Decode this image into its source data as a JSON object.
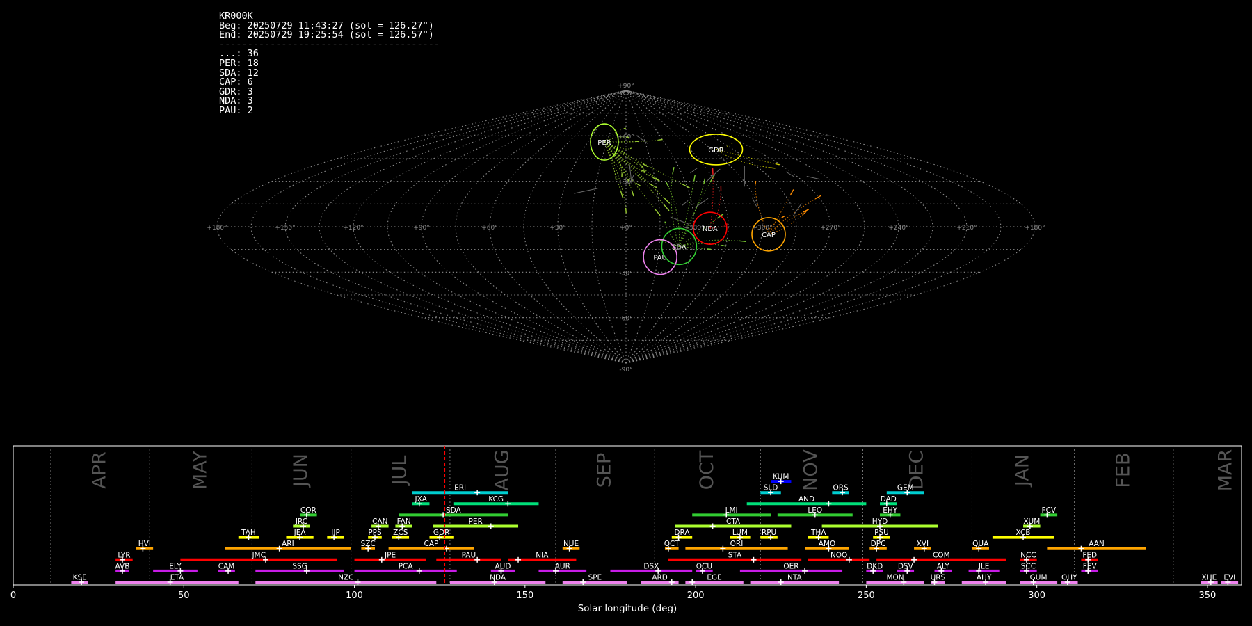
{
  "info": {
    "station": "KR000K",
    "beg": "Beg: 20250729 11:43:27 (sol = 126.27°)",
    "end": "End: 20250729 19:25:54 (sol = 126.57°)",
    "separator": "---------------------------------------",
    "counts": [
      {
        "code": "...",
        "n": 36
      },
      {
        "code": "PER",
        "n": 18
      },
      {
        "code": "SDA",
        "n": 12
      },
      {
        "code": "CAP",
        "n": 6
      },
      {
        "code": "GDR",
        "n": 3
      },
      {
        "code": "NDA",
        "n": 3
      },
      {
        "code": "PAU",
        "n": 2
      }
    ]
  },
  "chart_data": [
    {
      "type": "scatter",
      "projection": "sinusoidal",
      "lon_tick_labels": [
        "+180°",
        "+150°",
        "+120°",
        "+90°",
        "+60°",
        "+30°",
        "+0°",
        "+330°",
        "+300°",
        "+270°",
        "+240°",
        "+210°",
        "+180°"
      ],
      "lat_tick_labels": [
        "+90°",
        "+60°",
        "+30°",
        "-30°",
        "-60°",
        "-90°"
      ],
      "radiants": [
        {
          "code": "PER",
          "lon": -17,
          "lat": 56,
          "color": "#adff2f",
          "rx": 20,
          "ry": 26
        },
        {
          "code": "GDR",
          "lon": 63,
          "lat": 51,
          "color": "#ffff00",
          "rx": 38,
          "ry": 22
        },
        {
          "code": "NDA",
          "lon": 37,
          "lat": -1,
          "color": "#ff0000",
          "rx": 24,
          "ry": 23
        },
        {
          "code": "CAP",
          "lon": 63,
          "lat": -5,
          "color": "#ffa500",
          "rx": 24,
          "ry": 24
        },
        {
          "code": "SDA",
          "lon": 24,
          "lat": -13,
          "color": "#32cd32",
          "rx": 25,
          "ry": 26
        },
        {
          "code": "PAU",
          "lon": 16,
          "lat": -20,
          "color": "#ee82ee",
          "rx": 24,
          "ry": 25
        }
      ],
      "grid": true
    },
    {
      "type": "gantt",
      "xlabel": "Solar longitude (deg)",
      "xlim": [
        0,
        360
      ],
      "xticks": [
        0,
        50,
        100,
        150,
        200,
        250,
        300,
        350
      ],
      "current_sol": 126.4,
      "months": [
        {
          "name": "APR",
          "start": 11
        },
        {
          "name": "MAY",
          "start": 40
        },
        {
          "name": "JUN",
          "start": 70
        },
        {
          "name": "JUL",
          "start": 99
        },
        {
          "name": "AUG",
          "start": 128
        },
        {
          "name": "SEP",
          "start": 159
        },
        {
          "name": "OCT",
          "start": 188
        },
        {
          "name": "NOV",
          "start": 219
        },
        {
          "name": "DEC",
          "start": 249
        },
        {
          "name": "JAN",
          "start": 281
        },
        {
          "name": "FEB",
          "start": 311
        },
        {
          "name": "MAR",
          "start": 340
        }
      ],
      "showers": [
        {
          "code": "KUM",
          "s": 222,
          "e": 228,
          "p": 225,
          "row": 10,
          "color": "#0000ff"
        },
        {
          "code": "ERI",
          "s": 117,
          "e": 145,
          "p": 136,
          "row": 9,
          "color": "#00ced1"
        },
        {
          "code": "SLD",
          "s": 219,
          "e": 225,
          "p": 222,
          "row": 9,
          "color": "#00ced1"
        },
        {
          "code": "ORS",
          "s": 240,
          "e": 245,
          "p": 243,
          "row": 9,
          "color": "#00ced1"
        },
        {
          "code": "GEM",
          "s": 256,
          "e": 267,
          "p": 262,
          "row": 9,
          "color": "#00ced1"
        },
        {
          "code": "JXA",
          "s": 117,
          "e": 122,
          "p": 119,
          "row": 8,
          "color": "#00e07a"
        },
        {
          "code": "KCG",
          "s": 129,
          "e": 154,
          "p": 145,
          "row": 8,
          "color": "#00e07a"
        },
        {
          "code": "AND",
          "s": 215,
          "e": 250,
          "p": 239,
          "row": 8,
          "color": "#00e07a"
        },
        {
          "code": "DAD",
          "s": 254,
          "e": 259,
          "p": 256,
          "row": 8,
          "color": "#00e07a"
        },
        {
          "code": "COR",
          "s": 84,
          "e": 89,
          "p": 86,
          "row": 7,
          "color": "#32cd32"
        },
        {
          "code": "SDA",
          "s": 113,
          "e": 145,
          "p": 126,
          "row": 7,
          "color": "#32cd32"
        },
        {
          "code": "LMI",
          "s": 199,
          "e": 222,
          "p": 209,
          "row": 7,
          "color": "#32cd32"
        },
        {
          "code": "LEO",
          "s": 224,
          "e": 246,
          "p": 235,
          "row": 7,
          "color": "#32cd32"
        },
        {
          "code": "EHY",
          "s": 254,
          "e": 260,
          "p": 257,
          "row": 7,
          "color": "#32cd32"
        },
        {
          "code": "FCV",
          "s": 301,
          "e": 306,
          "p": 303,
          "row": 7,
          "color": "#32cd32"
        },
        {
          "code": "JRC",
          "s": 82,
          "e": 87,
          "p": 85,
          "row": 6,
          "color": "#adff2f"
        },
        {
          "code": "CAN",
          "s": 105,
          "e": 110,
          "p": 107,
          "row": 6,
          "color": "#adff2f"
        },
        {
          "code": "FAN",
          "s": 112,
          "e": 117,
          "p": 114,
          "row": 6,
          "color": "#adff2f"
        },
        {
          "code": "PER",
          "s": 123,
          "e": 148,
          "p": 140,
          "row": 6,
          "color": "#adff2f"
        },
        {
          "code": "CTA",
          "s": 194,
          "e": 228,
          "p": 205,
          "row": 6,
          "color": "#adff2f"
        },
        {
          "code": "HYD",
          "s": 237,
          "e": 271,
          "p": 254,
          "row": 6,
          "color": "#adff2f"
        },
        {
          "code": "XUM",
          "s": 296,
          "e": 301,
          "p": 298,
          "row": 6,
          "color": "#adff2f"
        },
        {
          "code": "TAH",
          "s": 66,
          "e": 72,
          "p": 69,
          "row": 5,
          "color": "#ffff00"
        },
        {
          "code": "JEA",
          "s": 80,
          "e": 88,
          "p": 84,
          "row": 5,
          "color": "#ffff00"
        },
        {
          "code": "JIP",
          "s": 92,
          "e": 97,
          "p": 94,
          "row": 5,
          "color": "#ffff00"
        },
        {
          "code": "PPS",
          "s": 104,
          "e": 108,
          "p": 106,
          "row": 5,
          "color": "#ffff00"
        },
        {
          "code": "ZCS",
          "s": 111,
          "e": 116,
          "p": 113,
          "row": 5,
          "color": "#ffff00"
        },
        {
          "code": "GDR",
          "s": 122,
          "e": 129,
          "p": 125,
          "row": 5,
          "color": "#ffff00"
        },
        {
          "code": "DRA",
          "s": 193,
          "e": 199,
          "p": 195,
          "row": 5,
          "color": "#ffff00"
        },
        {
          "code": "LUM",
          "s": 210,
          "e": 216,
          "p": 213,
          "row": 5,
          "color": "#ffff00"
        },
        {
          "code": "RPU",
          "s": 219,
          "e": 224,
          "p": 222,
          "row": 5,
          "color": "#ffff00"
        },
        {
          "code": "THA",
          "s": 233,
          "e": 239,
          "p": 236,
          "row": 5,
          "color": "#ffff00"
        },
        {
          "code": "PSU",
          "s": 252,
          "e": 257,
          "p": 254,
          "row": 5,
          "color": "#ffff00"
        },
        {
          "code": "XCB",
          "s": 287,
          "e": 305,
          "p": 296,
          "row": 5,
          "color": "#ffff00"
        },
        {
          "code": "HVI",
          "s": 36,
          "e": 41,
          "p": 38,
          "row": 4,
          "color": "#ffa500"
        },
        {
          "code": "ARI",
          "s": 62,
          "e": 99,
          "p": 78,
          "row": 4,
          "color": "#ffa500"
        },
        {
          "code": "SZC",
          "s": 102,
          "e": 106,
          "p": 104,
          "row": 4,
          "color": "#ffa500"
        },
        {
          "code": "CAP",
          "s": 110,
          "e": 135,
          "p": 127,
          "row": 4,
          "color": "#ffa500"
        },
        {
          "code": "NUE",
          "s": 161,
          "e": 166,
          "p": 163,
          "row": 4,
          "color": "#ffa500"
        },
        {
          "code": "OCT",
          "s": 191,
          "e": 195,
          "p": 192,
          "row": 4,
          "color": "#ffa500"
        },
        {
          "code": "ORI",
          "s": 197,
          "e": 227,
          "p": 208,
          "row": 4,
          "color": "#ffa500"
        },
        {
          "code": "AMO",
          "s": 232,
          "e": 245,
          "p": 239,
          "row": 4,
          "color": "#ffa500"
        },
        {
          "code": "DPC",
          "s": 251,
          "e": 256,
          "p": 253,
          "row": 4,
          "color": "#ffa500"
        },
        {
          "code": "XVI",
          "s": 264,
          "e": 269,
          "p": 267,
          "row": 4,
          "color": "#ffa500"
        },
        {
          "code": "QUA",
          "s": 281,
          "e": 286,
          "p": 283,
          "row": 4,
          "color": "#ffa500"
        },
        {
          "code": "AAN",
          "s": 303,
          "e": 332,
          "p": 313,
          "row": 4,
          "color": "#ffa500"
        },
        {
          "code": "LYR",
          "s": 30,
          "e": 35,
          "p": 32,
          "row": 3,
          "color": "#ff0000"
        },
        {
          "code": "JMC",
          "s": 49,
          "e": 95,
          "p": 74,
          "row": 3,
          "color": "#ff0000"
        },
        {
          "code": "JPE",
          "s": 100,
          "e": 121,
          "p": 108,
          "row": 3,
          "color": "#ff0000"
        },
        {
          "code": "PAU",
          "s": 124,
          "e": 143,
          "p": 136,
          "row": 3,
          "color": "#ff0000"
        },
        {
          "code": "NIA",
          "s": 145,
          "e": 165,
          "p": 148,
          "row": 3,
          "color": "#ff0000"
        },
        {
          "code": "STA",
          "s": 192,
          "e": 231,
          "p": 217,
          "row": 3,
          "color": "#ff0000"
        },
        {
          "code": "NOO",
          "s": 233,
          "e": 251,
          "p": 245,
          "row": 3,
          "color": "#ff0000"
        },
        {
          "code": "COM",
          "s": 253,
          "e": 291,
          "p": 264,
          "row": 3,
          "color": "#ff0000"
        },
        {
          "code": "NCC",
          "s": 295,
          "e": 300,
          "p": 297,
          "row": 3,
          "color": "#ff0000"
        },
        {
          "code": "FED",
          "s": 313,
          "e": 318,
          "p": 315,
          "row": 3,
          "color": "#ff0000"
        },
        {
          "code": "AVB",
          "s": 30,
          "e": 34,
          "p": 32,
          "row": 2,
          "color": "#c71ce6"
        },
        {
          "code": "ELY",
          "s": 41,
          "e": 54,
          "p": 49,
          "row": 2,
          "color": "#c71ce6"
        },
        {
          "code": "CAM",
          "s": 60,
          "e": 65,
          "p": 63,
          "row": 2,
          "color": "#c71ce6"
        },
        {
          "code": "SSG",
          "s": 71,
          "e": 97,
          "p": 86,
          "row": 2,
          "color": "#c71ce6"
        },
        {
          "code": "PCA",
          "s": 100,
          "e": 130,
          "p": 119,
          "row": 2,
          "color": "#c71ce6"
        },
        {
          "code": "AUD",
          "s": 140,
          "e": 147,
          "p": 143,
          "row": 2,
          "color": "#c71ce6"
        },
        {
          "code": "AUR",
          "s": 154,
          "e": 168,
          "p": 159,
          "row": 2,
          "color": "#c71ce6"
        },
        {
          "code": "DSX",
          "s": 175,
          "e": 199,
          "p": 189,
          "row": 2,
          "color": "#c71ce6"
        },
        {
          "code": "OCU",
          "s": 200,
          "e": 205,
          "p": 202,
          "row": 2,
          "color": "#c71ce6"
        },
        {
          "code": "OER",
          "s": 213,
          "e": 243,
          "p": 232,
          "row": 2,
          "color": "#c71ce6"
        },
        {
          "code": "DKD",
          "s": 250,
          "e": 255,
          "p": 252,
          "row": 2,
          "color": "#c71ce6"
        },
        {
          "code": "DSV",
          "s": 259,
          "e": 264,
          "p": 262,
          "row": 2,
          "color": "#c71ce6"
        },
        {
          "code": "ALY",
          "s": 270,
          "e": 275,
          "p": 272,
          "row": 2,
          "color": "#c71ce6"
        },
        {
          "code": "JLE",
          "s": 280,
          "e": 289,
          "p": 283,
          "row": 2,
          "color": "#c71ce6"
        },
        {
          "code": "SCC",
          "s": 295,
          "e": 300,
          "p": 297,
          "row": 2,
          "color": "#c71ce6"
        },
        {
          "code": "FEV",
          "s": 313,
          "e": 318,
          "p": 315,
          "row": 2,
          "color": "#c71ce6"
        },
        {
          "code": "KSE",
          "s": 17,
          "e": 22,
          "p": 20,
          "row": 1,
          "color": "#ee82ee"
        },
        {
          "code": "ETA",
          "s": 30,
          "e": 66,
          "p": 46,
          "row": 1,
          "color": "#ee82ee"
        },
        {
          "code": "NZC",
          "s": 71,
          "e": 124,
          "p": 101,
          "row": 1,
          "color": "#ee82ee"
        },
        {
          "code": "NDA",
          "s": 128,
          "e": 156,
          "p": 141,
          "row": 1,
          "color": "#ee82ee"
        },
        {
          "code": "SPE",
          "s": 161,
          "e": 180,
          "p": 167,
          "row": 1,
          "color": "#ee82ee"
        },
        {
          "code": "ARD",
          "s": 184,
          "e": 195,
          "p": 193,
          "row": 1,
          "color": "#ee82ee"
        },
        {
          "code": "EGE",
          "s": 197,
          "e": 214,
          "p": 199,
          "row": 1,
          "color": "#ee82ee"
        },
        {
          "code": "NTA",
          "s": 216,
          "e": 242,
          "p": 225,
          "row": 1,
          "color": "#ee82ee"
        },
        {
          "code": "MON",
          "s": 250,
          "e": 267,
          "p": 261,
          "row": 1,
          "color": "#ee82ee"
        },
        {
          "code": "URS",
          "s": 269,
          "e": 273,
          "p": 270,
          "row": 1,
          "color": "#ee82ee"
        },
        {
          "code": "AHY",
          "s": 278,
          "e": 291,
          "p": 285,
          "row": 1,
          "color": "#ee82ee"
        },
        {
          "code": "GUM",
          "s": 295,
          "e": 306,
          "p": 299,
          "row": 1,
          "color": "#ee82ee"
        },
        {
          "code": "OHY",
          "s": 307,
          "e": 312,
          "p": 309,
          "row": 1,
          "color": "#ee82ee"
        },
        {
          "code": "XHE",
          "s": 348,
          "e": 353,
          "p": 351,
          "row": 1,
          "color": "#ee82ee"
        },
        {
          "code": "EVI",
          "s": 354,
          "e": 359,
          "p": 356,
          "row": 1,
          "color": "#ee82ee"
        }
      ]
    }
  ]
}
